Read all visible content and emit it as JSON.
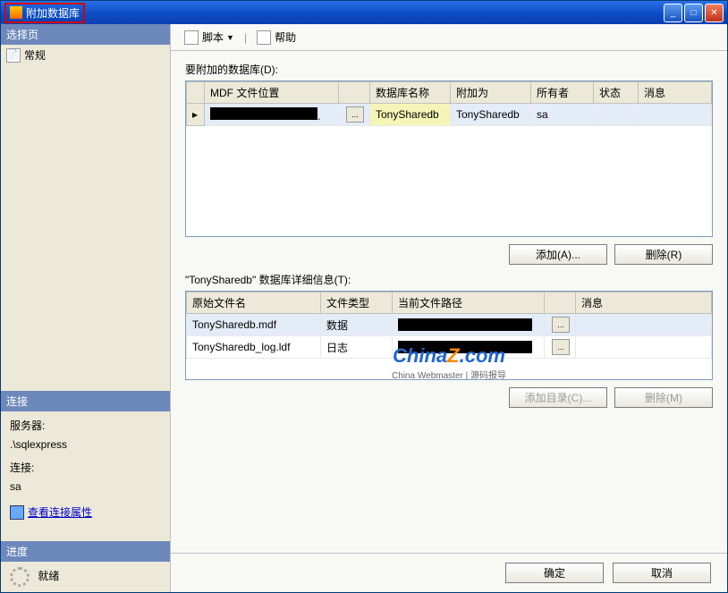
{
  "window": {
    "title": "附加数据库",
    "controls": {
      "minimize": "_",
      "maximize": "□",
      "close": "✕"
    }
  },
  "sidebar": {
    "select_page_header": "选择页",
    "general_item": "常规",
    "connection_header": "连接",
    "server_label": "服务器:",
    "server_value": ".\\sqlexpress",
    "conn_label": "连接:",
    "conn_value": "sa",
    "view_conn_props": "查看连接属性",
    "progress_header": "进度",
    "progress_status": "就绪"
  },
  "toolbar": {
    "script_label": "脚本",
    "help_label": "帮助"
  },
  "main": {
    "attach_section_label": "要附加的数据库(D):",
    "grid1_headers": [
      "",
      "MDF 文件位置",
      "",
      "数据库名称",
      "附加为",
      "所有者",
      "状态",
      "消息"
    ],
    "grid1_row": {
      "mdf_location": "",
      "db_name": "TonySharedb",
      "attach_as": "TonySharedb",
      "owner": "sa",
      "status": "",
      "message": ""
    },
    "add_btn": "添加(A)...",
    "remove_btn": "删除(R)",
    "details_label": "\"TonySharedb\" 数据库详细信息(T):",
    "grid2_headers": [
      "原始文件名",
      "文件类型",
      "当前文件路径",
      "",
      "消息"
    ],
    "grid2_rows": [
      {
        "filename": "TonySharedb.mdf",
        "filetype": "数据",
        "path": "",
        "message": ""
      },
      {
        "filename": "TonySharedb_log.ldf",
        "filetype": "日志",
        "path": "",
        "message": ""
      }
    ],
    "add_dir_btn": "添加目录(C)...",
    "remove2_btn": "删除(M)"
  },
  "footer": {
    "ok": "确定",
    "cancel": "取消"
  },
  "watermark": {
    "text1": "China",
    "text2": "Z",
    "text3": ".com",
    "tagline": "China Webmaster | 源码报导"
  }
}
